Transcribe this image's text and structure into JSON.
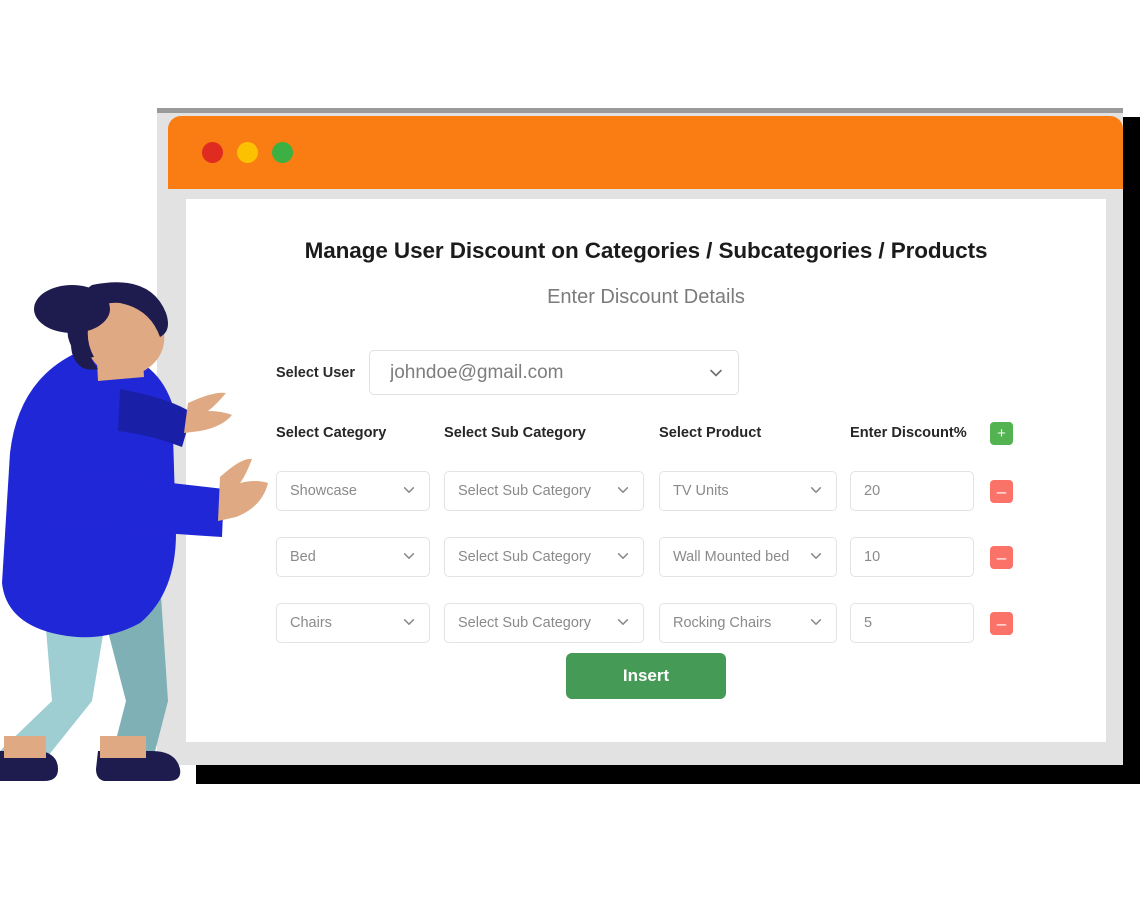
{
  "window": {
    "traffic_lights": [
      {
        "name": "close-dot",
        "color": "#e02b20"
      },
      {
        "name": "minimize-dot",
        "color": "#fcc202"
      },
      {
        "name": "maximize-dot",
        "color": "#3cb043"
      }
    ],
    "titlebar_color": "#f97d12",
    "frame_color": "#e2e2e2"
  },
  "page": {
    "title": "Manage User Discount on Categories / Subcategories / Products",
    "subtitle": "Enter Discount Details"
  },
  "user_row": {
    "label": "Select User",
    "selected": "johndoe@gmail.com",
    "chevron_icon": "chevron-down-icon"
  },
  "table": {
    "headers": {
      "category": "Select Category",
      "subcategory": "Select Sub Category",
      "product": "Select Product",
      "discount": "Enter Discount%"
    },
    "add_button_label": "+",
    "add_button_color": "#52b350",
    "remove_button_label": "–",
    "remove_button_color": "#fa7268",
    "rows": [
      {
        "category": "Showcase",
        "subcategory": "Select Sub Category",
        "product": "TV Units",
        "discount": "20"
      },
      {
        "category": "Bed",
        "subcategory": "Select Sub Category",
        "product": "Wall Mounted bed",
        "discount": "10"
      },
      {
        "category": "Chairs",
        "subcategory": "Select Sub Category",
        "product": "Rocking Chairs",
        "discount": "5"
      }
    ]
  },
  "actions": {
    "insert_label": "Insert",
    "insert_color": "#459a55"
  },
  "illustration": {
    "name": "person-pointing-illustration",
    "hair_color": "#1e1b4e",
    "skin_color": "#dfa983",
    "shirt_color": "#2027d6",
    "shirt_dark_color": "#1a1fa8",
    "pants_light_color": "#9ecdd2",
    "pants_dark_color": "#7fb0b5",
    "shoe_color": "#1e1b4e"
  }
}
